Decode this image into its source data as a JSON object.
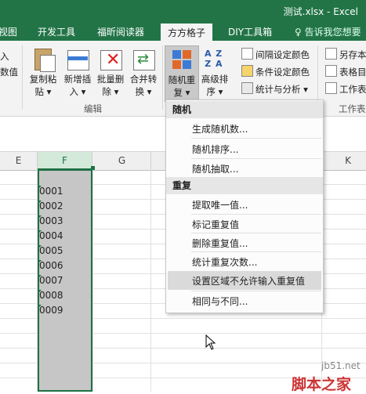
{
  "window": {
    "title": "测试.xlsx - Excel"
  },
  "tabs": [
    "视图",
    "开发工具",
    "福昕阅读器",
    "方方格子",
    "DIY工具箱"
  ],
  "active_tab": "方方格子",
  "tell_me": "告诉我您想要",
  "ribbon": {
    "left_partial": [
      "入",
      "数值"
    ],
    "buttons": [
      {
        "label1": "复制粘",
        "label2": "贴 ▾"
      },
      {
        "label1": "新增插",
        "label2": "入 ▾"
      },
      {
        "label1": "批量删",
        "label2": "除 ▾"
      },
      {
        "label1": "合并转",
        "label2": "换 ▾"
      },
      {
        "label1": "随机重",
        "label2": "复 ▾"
      },
      {
        "label1": "高级排",
        "label2": "序 ▾"
      }
    ],
    "group_edit": "编辑",
    "small_items": [
      "间隔设定颜色",
      "条件设定颜色",
      "统计与分析 ▾"
    ],
    "right_items": [
      "另存本",
      "表格目",
      "工作表"
    ],
    "right_group": "工作表"
  },
  "columns": [
    "E",
    "F",
    "G",
    "K"
  ],
  "cells_F": [
    "0001",
    "0002",
    "0003",
    "0004",
    "0005",
    "0006",
    "0007",
    "0008",
    "0009"
  ],
  "menu": {
    "sections": [
      {
        "header": "随机",
        "items": [
          "生成随机数...",
          "随机排序...",
          "随机抽取..."
        ]
      },
      {
        "header": "重复",
        "items": [
          "提取唯一值...",
          "标记重复值",
          "删除重复值...",
          "统计重复次数...",
          "设置区域不允许输入重复值",
          "相同与不同..."
        ]
      }
    ],
    "highlighted": "设置区域不允许输入重复值"
  },
  "watermark": {
    "site": "jb51.net",
    "brand": "脚本之家"
  }
}
